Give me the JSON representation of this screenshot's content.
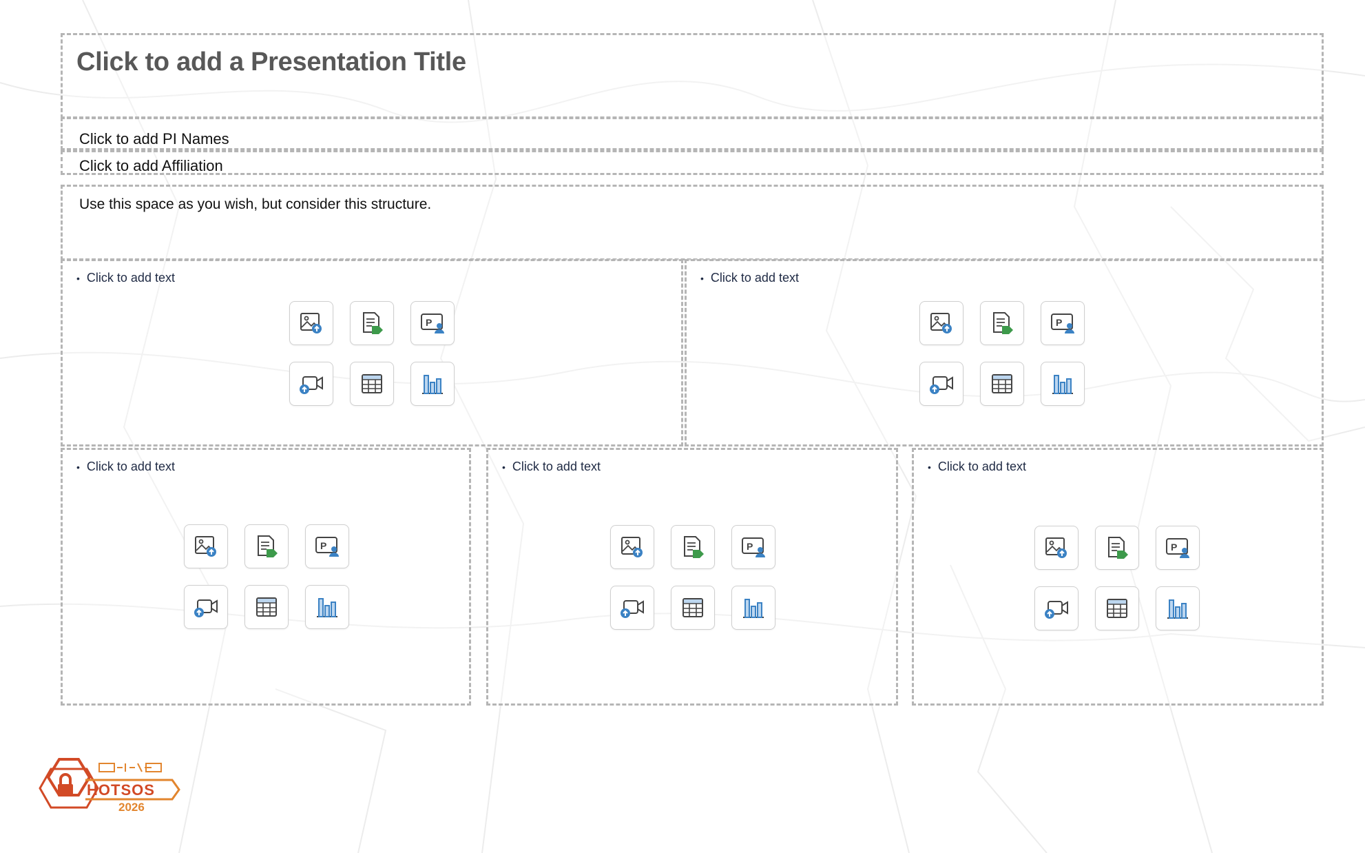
{
  "slide": {
    "title_placeholder": "Click to add a Presentation Title",
    "pi_placeholder": "Click to add PI Names",
    "affiliation_placeholder": "Click to add Affiliation",
    "description_text": "Use this space as you wish, but consider this structure."
  },
  "content_boxes": [
    {
      "bullet_text": "Click to add text"
    },
    {
      "bullet_text": "Click to add text"
    },
    {
      "bullet_text": "Click to add text"
    },
    {
      "bullet_text": "Click to add text"
    },
    {
      "bullet_text": "Click to add text"
    }
  ],
  "insert_icons": [
    "insert-picture-icon",
    "insert-document-icon",
    "insert-cameo-icon",
    "insert-video-icon",
    "insert-table-icon",
    "insert-chart-icon"
  ],
  "logo": {
    "name": "HOTSOS",
    "year": "2026",
    "colors": {
      "primary": "#d24a26",
      "secondary": "#e2852e"
    }
  },
  "colors": {
    "placeholder_border": "#b5b5b5",
    "title_text": "#585858",
    "icon_blue": "#3b82c4",
    "icon_green": "#3d9a4b"
  }
}
